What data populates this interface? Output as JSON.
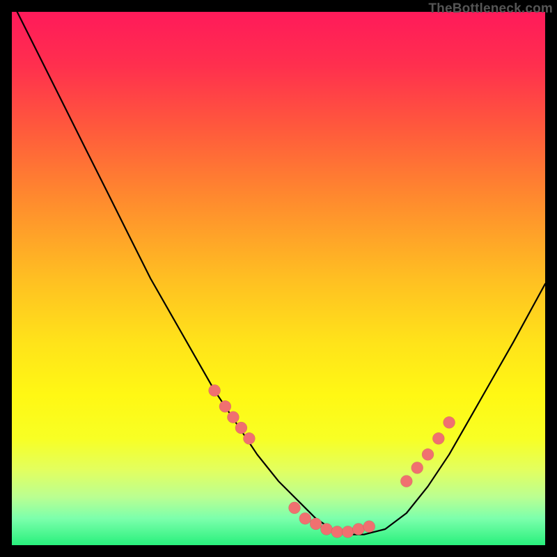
{
  "watermark": "TheBottleneck.com",
  "colors": {
    "dot": "#f07070",
    "curve": "#000000"
  },
  "chart_data": {
    "type": "line",
    "title": "",
    "xlabel": "",
    "ylabel": "",
    "xlim": [
      0,
      100
    ],
    "ylim": [
      0,
      100
    ],
    "grid": false,
    "series": [
      {
        "name": "bottleneck-curve",
        "x": [
          0,
          3,
          6,
          10,
          14,
          18,
          22,
          26,
          30,
          34,
          38,
          42,
          46,
          50,
          54,
          57,
          60,
          63,
          66,
          70,
          74,
          78,
          82,
          86,
          90,
          94,
          100
        ],
        "y": [
          102,
          96,
          90,
          82,
          74,
          66,
          58,
          50,
          43,
          36,
          29,
          23,
          17,
          12,
          8,
          5,
          3,
          2,
          2,
          3,
          6,
          11,
          17,
          24,
          31,
          38,
          49
        ]
      }
    ],
    "markers": [
      {
        "name": "left-cluster",
        "x": [
          38,
          40,
          41.5,
          43,
          44.5
        ],
        "y": [
          29,
          26,
          24,
          22,
          20
        ]
      },
      {
        "name": "bottom-cluster",
        "x": [
          53,
          55,
          57,
          59,
          61,
          63,
          65,
          67
        ],
        "y": [
          7,
          5,
          4,
          3,
          2.5,
          2.5,
          3,
          3.5
        ]
      },
      {
        "name": "right-cluster",
        "x": [
          74,
          76,
          78,
          80,
          82
        ],
        "y": [
          12,
          14.5,
          17,
          20,
          23
        ]
      }
    ]
  }
}
